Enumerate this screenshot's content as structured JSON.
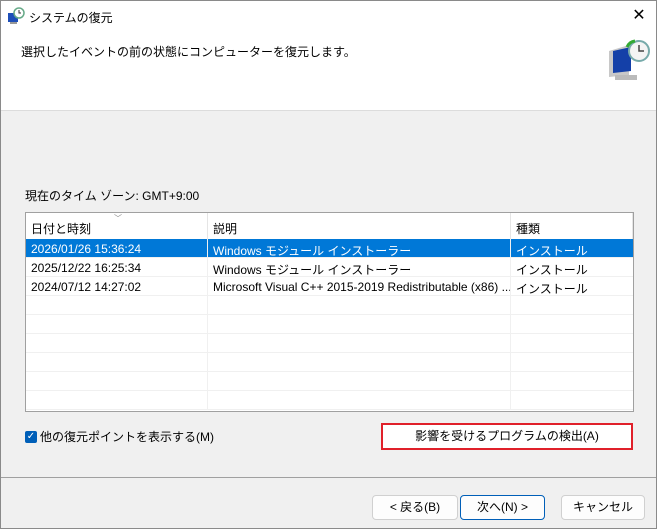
{
  "window": {
    "title": "システムの復元",
    "close_icon": "close-icon"
  },
  "header": {
    "text": "選択したイベントの前の状態にコンピューターを復元します。"
  },
  "timezone": "現在のタイム ゾーン: GMT+9:00",
  "table": {
    "columns": [
      "日付と時刻",
      "説明",
      "種類"
    ],
    "rows": [
      {
        "date": "2026/01/26 15:36:24",
        "desc": "Windows モジュール インストーラー",
        "type": "インストール",
        "selected": true
      },
      {
        "date": "2025/12/22 16:25:34",
        "desc": "Windows モジュール インストーラー",
        "type": "インストール"
      },
      {
        "date": "2024/07/12 14:27:02",
        "desc": "Microsoft Visual C++ 2015-2019 Redistributable (x86) ...",
        "type": "インストール"
      }
    ]
  },
  "checkbox": {
    "label": "他の復元ポイントを表示する(M)",
    "checked": true
  },
  "buttons": {
    "detect": "影響を受けるプログラムの検出(A)",
    "back": "< 戻る(B)",
    "next": "次へ(N) >",
    "cancel": "キャンセル"
  },
  "colors": {
    "selection": "#0078d7",
    "highlight_border": "#e0202a"
  }
}
